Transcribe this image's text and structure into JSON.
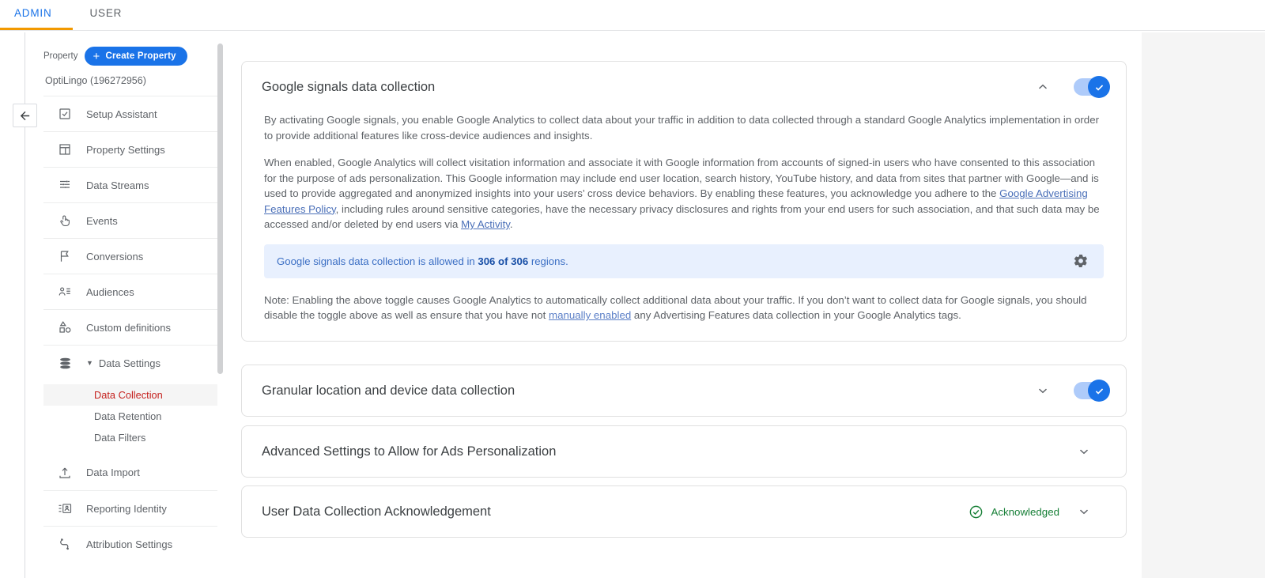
{
  "tabs": [
    {
      "label": "ADMIN",
      "active": true
    },
    {
      "label": "USER",
      "active": false
    }
  ],
  "sidebar": {
    "property_label": "Property",
    "create_button": "Create Property",
    "property_name": "OptiLingo (196272956)",
    "items": [
      {
        "label": "Setup Assistant",
        "icon": "clipboard-check-icon"
      },
      {
        "label": "Property Settings",
        "icon": "window-icon"
      },
      {
        "label": "Data Streams",
        "icon": "data-streams-icon"
      },
      {
        "label": "Events",
        "icon": "tap-icon"
      },
      {
        "label": "Conversions",
        "icon": "flag-icon"
      },
      {
        "label": "Audiences",
        "icon": "audience-icon"
      },
      {
        "label": "Custom definitions",
        "icon": "shapes-icon"
      },
      {
        "label": "Data Settings",
        "icon": "database-icon",
        "expanded": true
      },
      {
        "label": "Data Import",
        "icon": "upload-icon"
      },
      {
        "label": "Reporting Identity",
        "icon": "reporting-identity-icon"
      },
      {
        "label": "Attribution Settings",
        "icon": "attribution-icon"
      }
    ],
    "sub_items": [
      {
        "label": "Data Collection",
        "selected": true
      },
      {
        "label": "Data Retention",
        "selected": false
      },
      {
        "label": "Data Filters",
        "selected": false
      }
    ]
  },
  "cards": {
    "google_signals": {
      "title": "Google signals data collection",
      "toggle_on": true,
      "expanded": true,
      "paragraph1": "By activating Google signals, you enable Google Analytics to collect data about your traffic in addition to data collected through a standard Google Analytics implementation in order to provide additional features like cross-device audiences and insights.",
      "paragraph2_part1": "When enabled, Google Analytics will collect visitation information and associate it with Google information from accounts of signed-in users who have consented to this association for the purpose of ads personalization. This Google information may include end user location, search history, YouTube history, and data from sites that partner with Google—and is used to provide aggregated and anonymized insights into your users’ cross device behaviors. By enabling these features, you acknowledge you adhere to the ",
      "paragraph2_link1": "Google Advertising Features Policy",
      "paragraph2_part2": ", including rules around sensitive categories, have the necessary privacy disclosures and rights from your end users for such association, and that such data may be accessed and/or deleted by end users via ",
      "paragraph2_link2": "My Activity",
      "paragraph2_part3": ".",
      "banner_text_part1": "Google signals data collection is allowed in ",
      "banner_text_bold": "306 of 306",
      "banner_text_part2": " regions.",
      "banner_icon": "gear-icon",
      "note_part1": "Note: Enabling the above toggle causes Google Analytics to automatically collect additional data about your traffic. If you don’t want to collect data for Google signals, you should disable the toggle above as well as ensure that you have not ",
      "note_link": "manually enabled",
      "note_part2": " any Advertising Features data collection in your Google Analytics tags."
    },
    "granular_location": {
      "title": "Granular location and device data collection",
      "toggle_on": true,
      "expanded": false
    },
    "advanced_settings": {
      "title": "Advanced Settings to Allow for Ads Personalization",
      "expanded": false
    },
    "user_data_ack": {
      "title": "User Data Collection Acknowledgement",
      "status": "Acknowledged",
      "status_icon": "check-circle-icon",
      "expanded": false
    }
  },
  "colors": {
    "accent_blue": "#1a73e8",
    "tab_underline": "#f29900",
    "selected_red": "#c5221f",
    "success_green": "#188038",
    "banner_bg": "#e8f0fe"
  }
}
